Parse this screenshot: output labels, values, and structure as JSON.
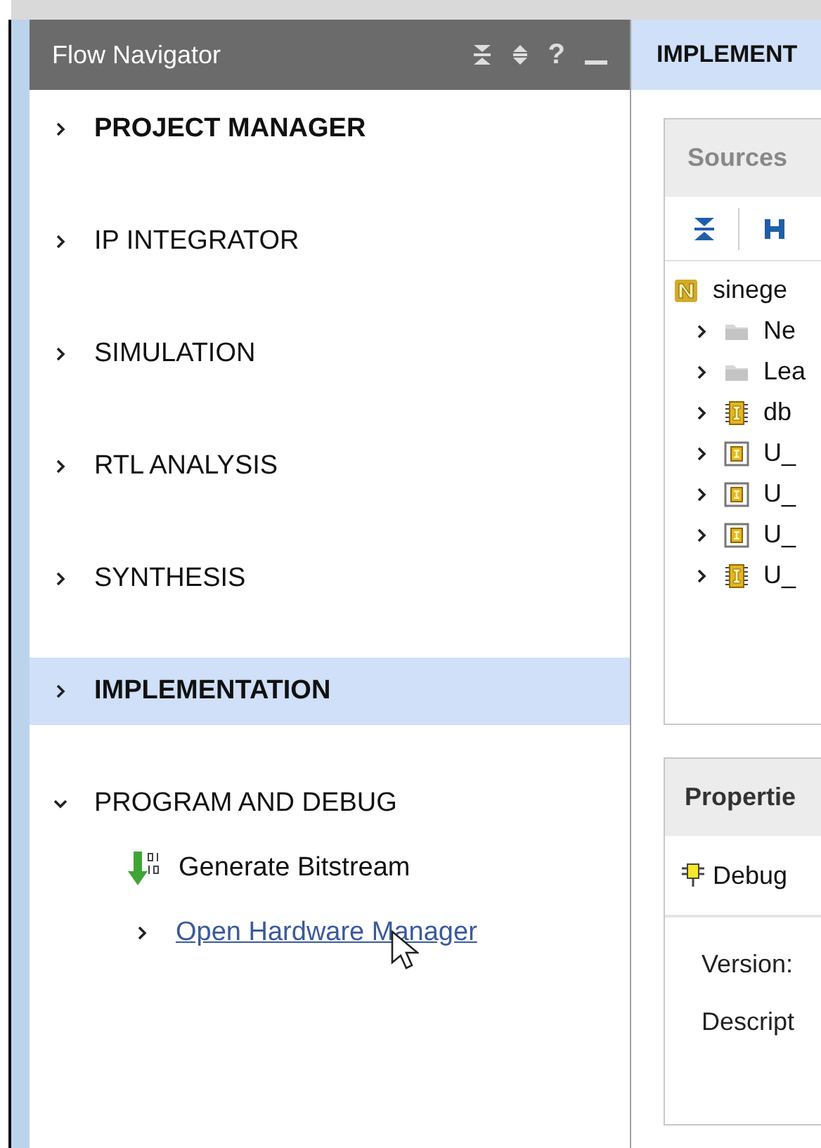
{
  "flow_navigator": {
    "title": "Flow Navigator",
    "help_label": "?",
    "sections": [
      {
        "label": "PROJECT MANAGER",
        "expanded": false,
        "selected": false,
        "emphasized": true
      },
      {
        "label": "IP INTEGRATOR",
        "expanded": false,
        "selected": false,
        "emphasized": false
      },
      {
        "label": "SIMULATION",
        "expanded": false,
        "selected": false,
        "emphasized": false
      },
      {
        "label": "RTL ANALYSIS",
        "expanded": false,
        "selected": false,
        "emphasized": false
      },
      {
        "label": "SYNTHESIS",
        "expanded": false,
        "selected": false,
        "emphasized": false
      },
      {
        "label": "IMPLEMENTATION",
        "expanded": false,
        "selected": true,
        "emphasized": true
      },
      {
        "label": "PROGRAM AND DEBUG",
        "expanded": true,
        "selected": false,
        "emphasized": false,
        "children": [
          {
            "kind": "action",
            "label": "Generate Bitstream"
          },
          {
            "kind": "link",
            "label": "Open Hardware Manager",
            "expanded": false
          }
        ]
      }
    ]
  },
  "main": {
    "title": "IMPLEMENT",
    "sources": {
      "title": "Sources",
      "tree": [
        {
          "kind": "netlist",
          "label": "sinege"
        },
        {
          "kind": "folder",
          "label": "Ne",
          "expanded": false
        },
        {
          "kind": "folder",
          "label": "Lea",
          "expanded": false
        },
        {
          "kind": "core",
          "label": "db",
          "expanded": false
        },
        {
          "kind": "instance",
          "label": "U_",
          "expanded": false
        },
        {
          "kind": "instance",
          "label": "U_",
          "expanded": false
        },
        {
          "kind": "instance",
          "label": "U_",
          "expanded": false
        },
        {
          "kind": "core",
          "label": "U_",
          "expanded": false
        }
      ]
    },
    "properties": {
      "title": "Propertie",
      "object": "Debug",
      "fields": [
        "Version:",
        "Descript"
      ]
    }
  }
}
